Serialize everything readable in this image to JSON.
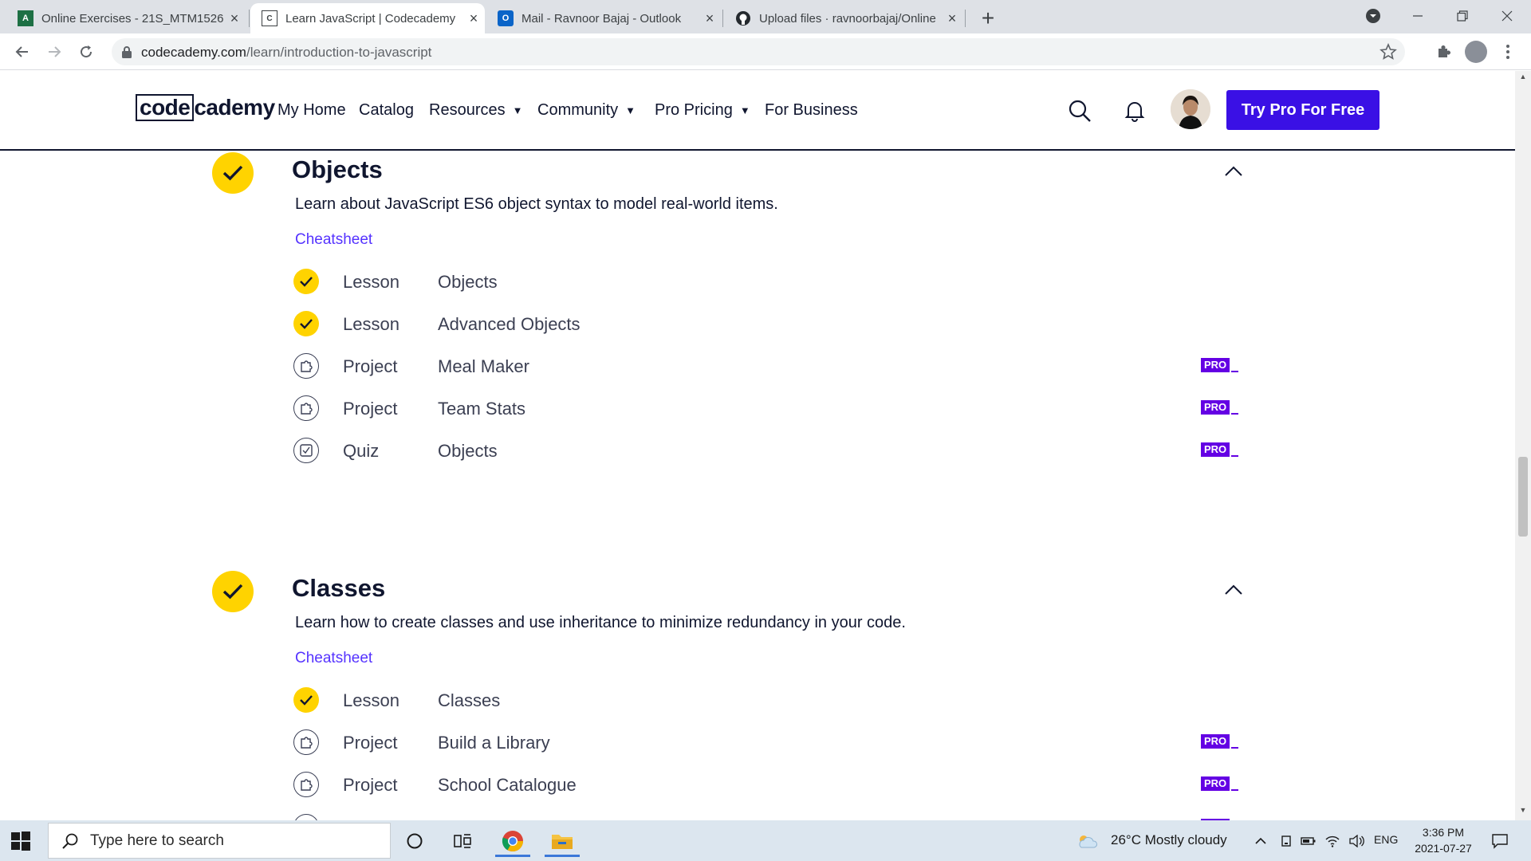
{
  "browser": {
    "tabs": [
      {
        "title": "Online Exercises - 21S_MTM1526",
        "active": false,
        "favicon": "excel-icon"
      },
      {
        "title": "Learn JavaScript | Codecademy",
        "active": true,
        "favicon": "codecademy-icon"
      },
      {
        "title": "Mail - Ravnoor Bajaj - Outlook",
        "active": false,
        "favicon": "outlook-icon"
      },
      {
        "title": "Upload files · ravnoorbajaj/Online",
        "active": false,
        "favicon": "github-icon"
      }
    ],
    "url_host": "codecademy.com",
    "url_path": "/learn/introduction-to-javascript"
  },
  "header": {
    "logo_a": "code",
    "logo_b": "cademy",
    "nav": [
      "My Home",
      "Catalog",
      "Resources",
      "Community",
      "Pro Pricing",
      "For Business"
    ],
    "cta": "Try Pro For Free"
  },
  "modules": [
    {
      "title": "Objects",
      "description": "Learn about JavaScript ES6 object syntax to model real-world items.",
      "cheatsheet": "Cheatsheet",
      "items": [
        {
          "kind": "Lesson",
          "name": "Objects",
          "status": "done",
          "pro": false
        },
        {
          "kind": "Lesson",
          "name": "Advanced Objects",
          "status": "done",
          "pro": false
        },
        {
          "kind": "Project",
          "name": "Meal Maker",
          "status": "project",
          "pro": true
        },
        {
          "kind": "Project",
          "name": "Team Stats",
          "status": "project",
          "pro": true
        },
        {
          "kind": "Quiz",
          "name": "Objects",
          "status": "quiz",
          "pro": true
        }
      ]
    },
    {
      "title": "Classes",
      "description": "Learn how to create classes and use inheritance to minimize redundancy in your code.",
      "cheatsheet": "Cheatsheet",
      "items": [
        {
          "kind": "Lesson",
          "name": "Classes",
          "status": "done",
          "pro": false
        },
        {
          "kind": "Project",
          "name": "Build a Library",
          "status": "project",
          "pro": true
        },
        {
          "kind": "Project",
          "name": "School Catalogue",
          "status": "project",
          "pro": true
        }
      ]
    }
  ],
  "pro_label": "PRO",
  "taskbar": {
    "search_placeholder": "Type here to search",
    "weather": "26°C  Mostly cloudy",
    "lang": "ENG",
    "time": "3:36 PM",
    "date": "2021-07-27"
  },
  "colors": {
    "accent": "#3a10e5",
    "check_yellow": "#ffd300",
    "pro_purple": "#6400e4",
    "link": "#5533ff"
  }
}
